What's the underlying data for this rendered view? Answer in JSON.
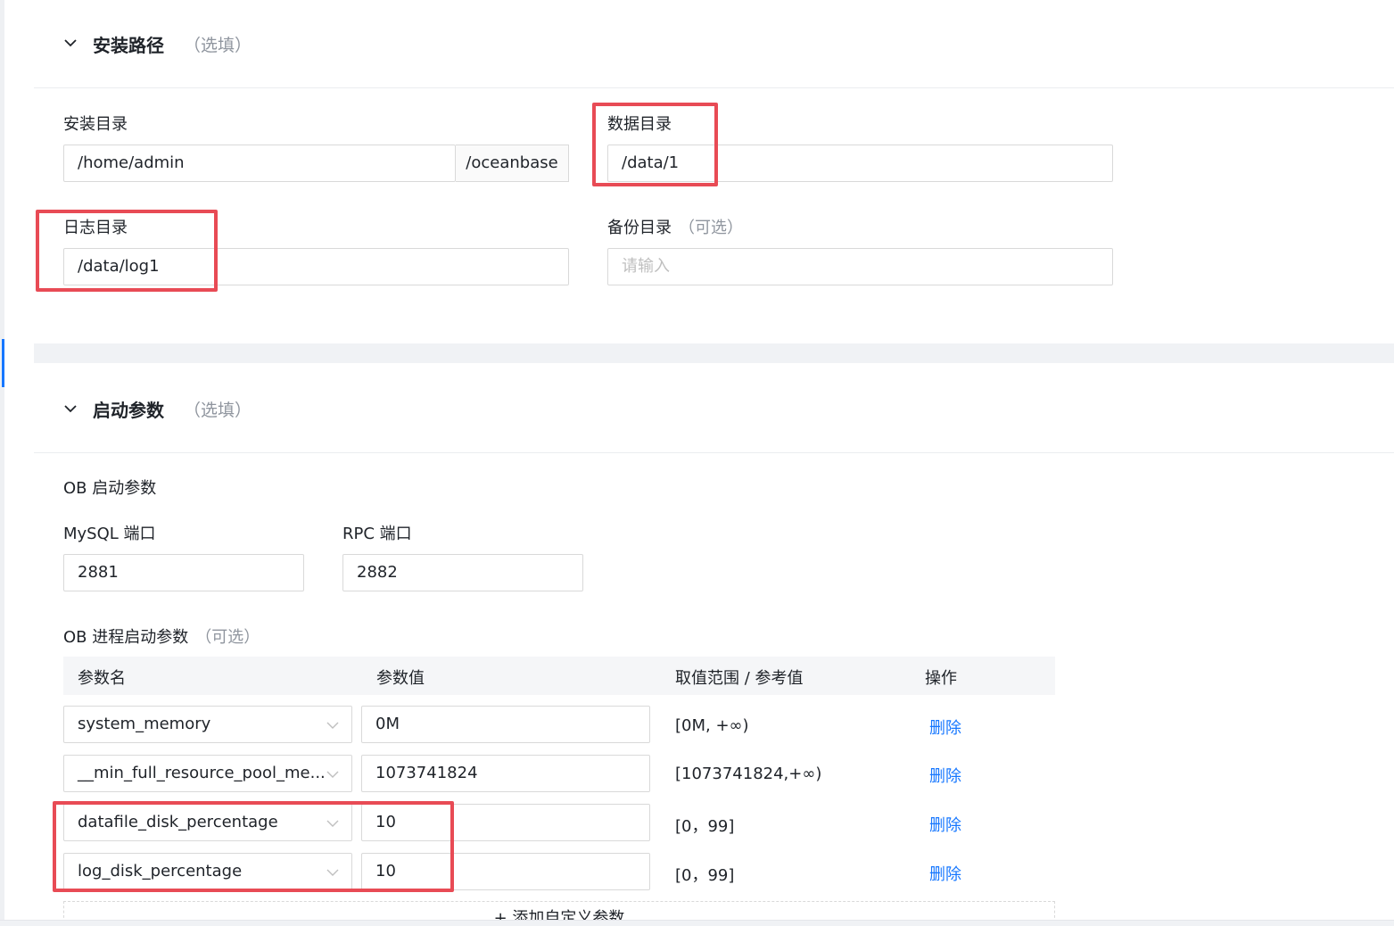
{
  "install_path": {
    "title": "安装路径",
    "optional": "（选填）",
    "install_dir": {
      "label": "安装目录",
      "value": "/home/admin",
      "suffix": "/oceanbase"
    },
    "data_dir": {
      "label": "数据目录",
      "value": "/data/1"
    },
    "log_dir": {
      "label": "日志目录",
      "value": "/data/log1"
    },
    "backup_dir": {
      "label": "备份目录",
      "optional": "（可选）",
      "placeholder": "请输入"
    }
  },
  "startup_params": {
    "title": "启动参数",
    "optional": "（选填）",
    "ob_params_label": "OB 启动参数",
    "mysql_port": {
      "label": "MySQL 端口",
      "value": "2881"
    },
    "rpc_port": {
      "label": "RPC 端口",
      "value": "2882"
    },
    "process_params": {
      "label": "OB 进程启动参数",
      "optional": "（可选）"
    },
    "table": {
      "headers": [
        "参数名",
        "参数值",
        "取值范围 / 参考值",
        "操作"
      ],
      "rows": [
        {
          "name": "system_memory",
          "value": "0M",
          "range": "[0M, +∞)",
          "action": "删除"
        },
        {
          "name": "__min_full_resource_pool_me...",
          "value": "1073741824",
          "range": "[1073741824,+∞)",
          "action": "删除"
        },
        {
          "name": "datafile_disk_percentage",
          "value": "10",
          "range": "[0，99]",
          "action": "删除"
        },
        {
          "name": "log_disk_percentage",
          "value": "10",
          "range": "[0，99]",
          "action": "删除"
        }
      ]
    },
    "add_button": "+ 添加自定义参数"
  },
  "colors": {
    "accent": "#1677ff",
    "highlight": "#e84b55"
  }
}
